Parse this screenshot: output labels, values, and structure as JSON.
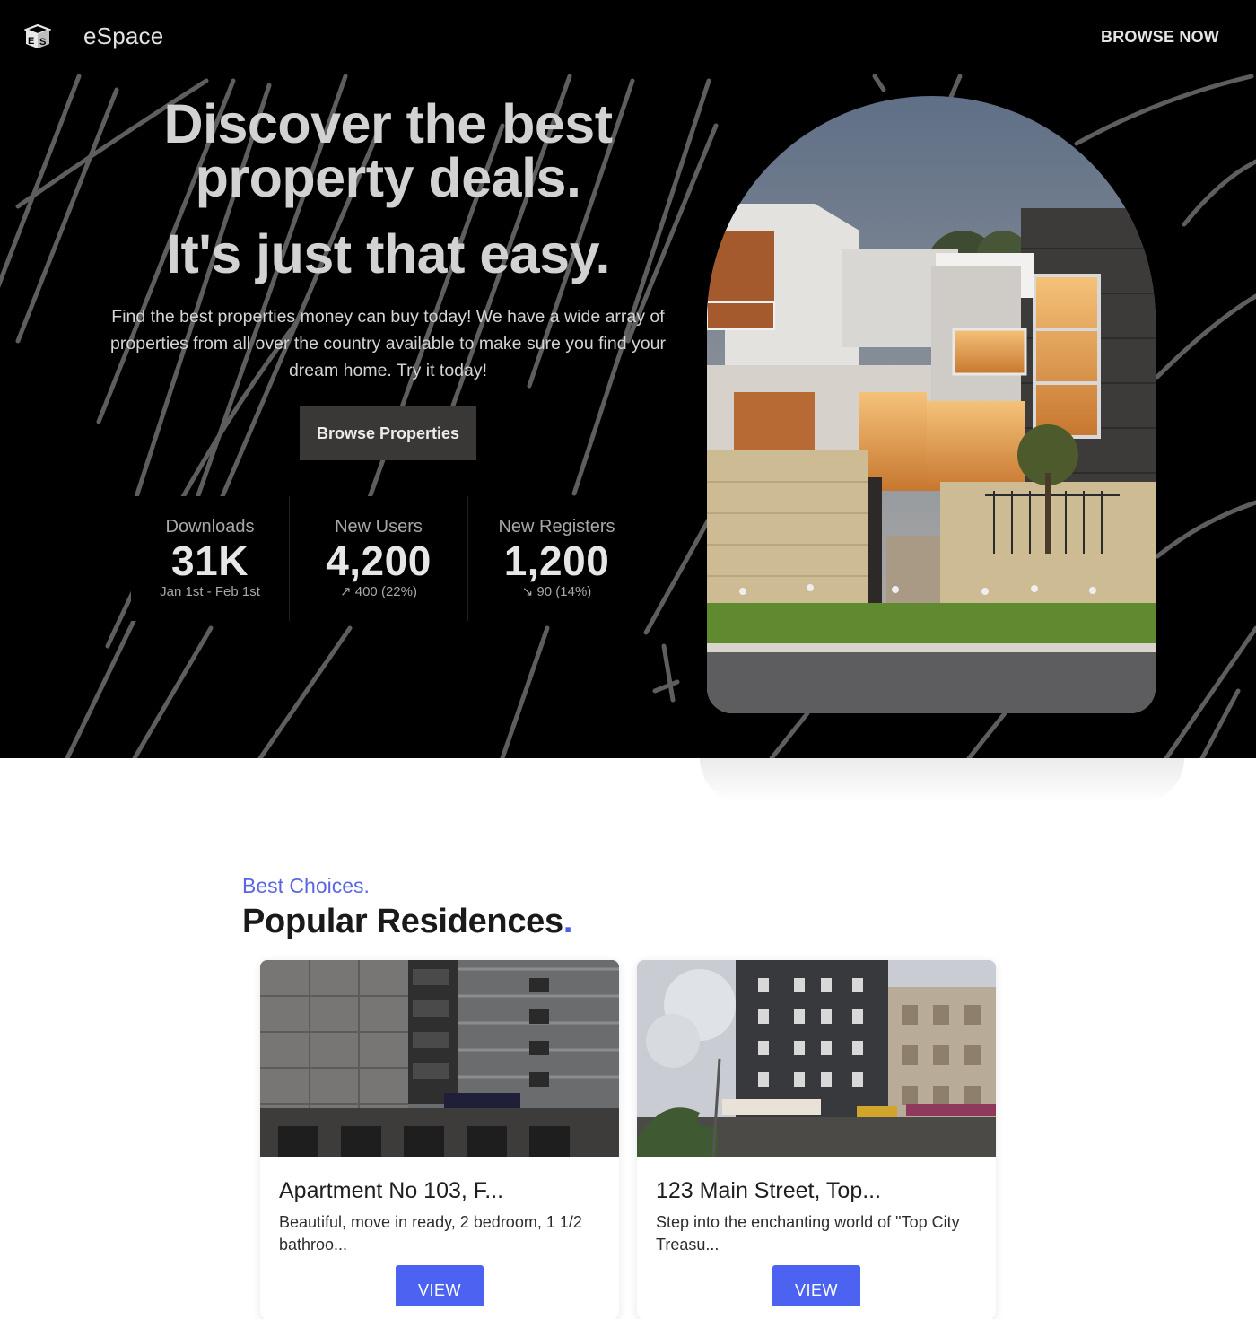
{
  "nav": {
    "brand": "eSpace",
    "cta": "BROWSE NOW"
  },
  "hero": {
    "headline": "Discover the best property deals.",
    "tagline": "It's just that easy.",
    "lead": "Find the best properties money can buy today! We have a wide array of properties from all over the country available to make sure you find your dream home. Try it today!",
    "button": "Browse Properties"
  },
  "stats": [
    {
      "title": "Downloads",
      "value": "31K",
      "desc": "Jan 1st - Feb 1st"
    },
    {
      "title": "New Users",
      "value": "4,200",
      "desc": "↗︎ 400 (22%)"
    },
    {
      "title": "New Registers",
      "value": "1,200",
      "desc": "↘︎ 90 (14%)"
    }
  ],
  "section": {
    "eyebrow": "Best Choices.",
    "title": "Popular Residences",
    "title_dot": "."
  },
  "cards": [
    {
      "title": "Apartment No 103, F...",
      "desc": "Beautiful, move in ready, 2 bedroom, 1 1/2 bathroo...",
      "button": "VIEW"
    },
    {
      "title": "123 Main Street, Top...",
      "desc": "Step into the enchanting world of \"Top City Treasu...",
      "button": "VIEW"
    }
  ],
  "colors": {
    "accent": "#4c63f1",
    "eyebrow": "#5b67e2",
    "hero_bg": "#000000",
    "hero_button": "#3a3737"
  },
  "icons": {
    "logo": "es-cube-logo-icon"
  }
}
